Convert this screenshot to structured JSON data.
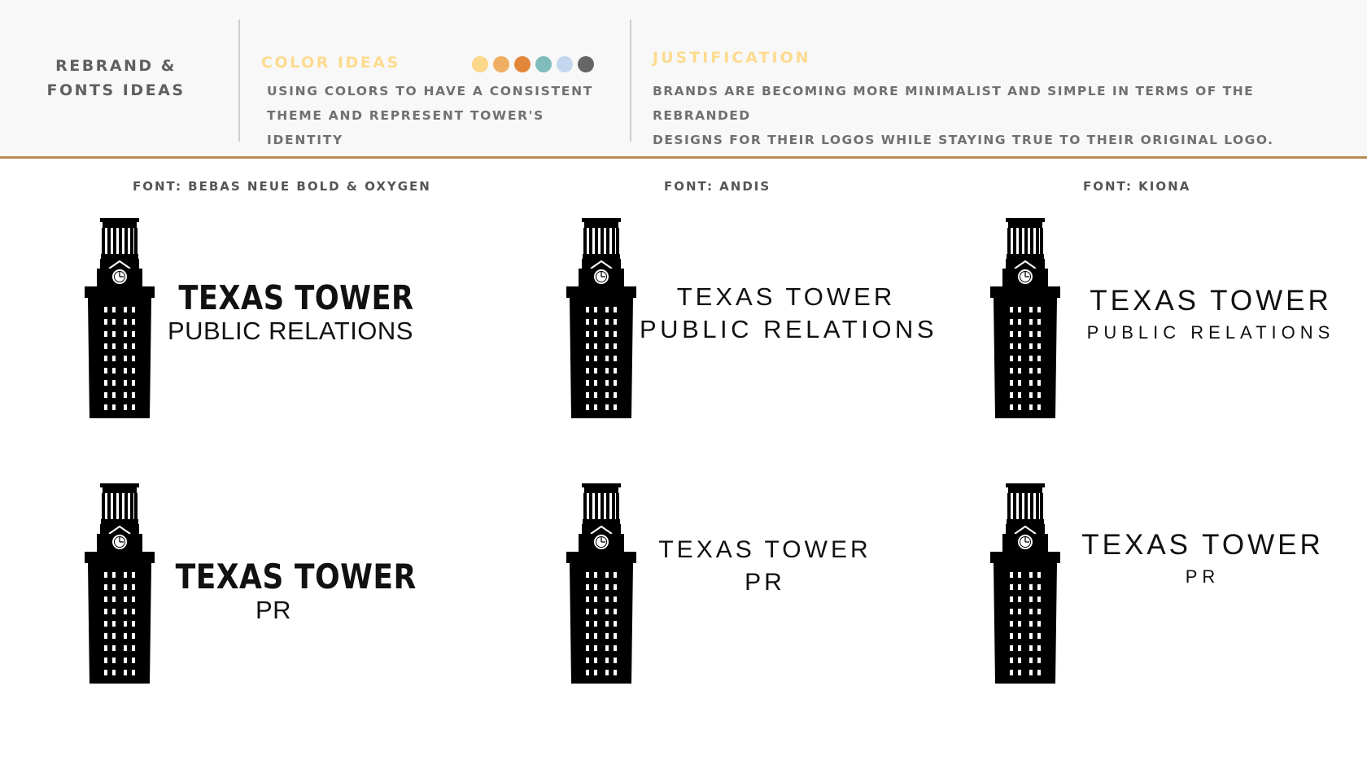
{
  "header": {
    "title_line1": "REBRAND &",
    "title_line2": "FONTS IDEAS",
    "color_ideas_title": "COLOR IDEAS",
    "color_ideas_line1": "USING COLORS TO HAVE A CONSISTENT",
    "color_ideas_line2": "THEME AND REPRESENT TOWER'S IDENTITY",
    "justification_title": "JUSTIFICATION",
    "justification_line1": "BRANDS ARE BECOMING MORE MINIMALIST AND SIMPLE IN TERMS OF THE REBRANDED",
    "justification_line2": "DESIGNS FOR THEIR LOGOS WHILE STAYING TRUE TO THEIR ORIGINAL LOGO.",
    "swatches": [
      "#fdd78a",
      "#efaf62",
      "#e2873a",
      "#7fbcbb",
      "#c4d7ef",
      "#666666"
    ],
    "accent_color": "#fddb8f",
    "rule_color": "#b98c57"
  },
  "columns": [
    {
      "font_label": "FONT: BEBAS NEUE BOLD & OXYGEN",
      "logo_full": {
        "title": "TEXAS TOWER",
        "subtitle": "PUBLIC RELATIONS"
      },
      "logo_short": {
        "title": "TEXAS TOWER",
        "subtitle": "PR"
      }
    },
    {
      "font_label": "FONT: ANDIS",
      "logo_full": {
        "title": "TEXAS TOWER",
        "subtitle": "PUBLIC RELATIONS"
      },
      "logo_short": {
        "title": "TEXAS TOWER",
        "subtitle": "PR"
      }
    },
    {
      "font_label": "FONT: KIONA",
      "logo_full": {
        "title": "TEXAS TOWER",
        "subtitle": "PUBLIC RELATIONS"
      },
      "logo_short": {
        "title": "TEXAS TOWER",
        "subtitle": "PR"
      }
    }
  ]
}
